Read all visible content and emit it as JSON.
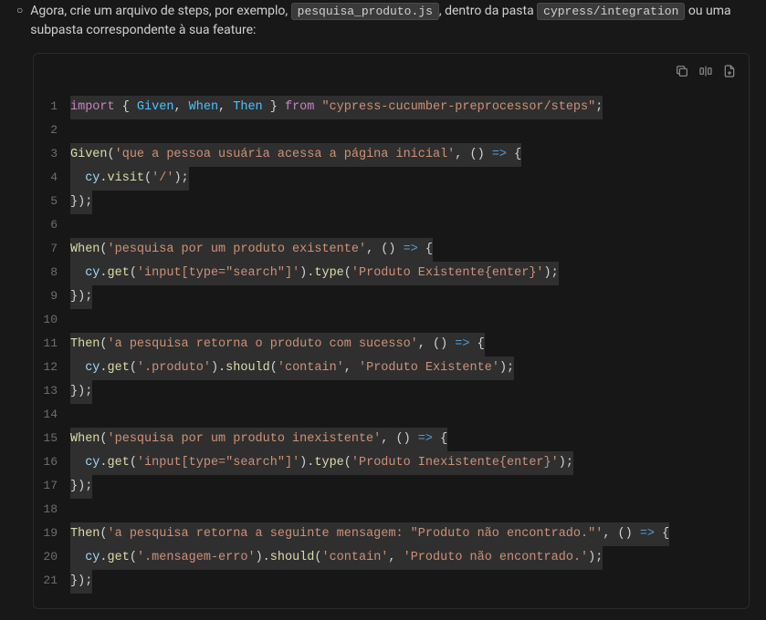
{
  "description": {
    "prefix": "Agora, crie um arquivo de steps, por exemplo, ",
    "file": "pesquisa_produto.js",
    "mid": ", dentro da pasta ",
    "folder": "cypress/integration",
    "suffix": " ou uma subpasta correspondente à sua feature:"
  },
  "toolbar": {
    "copy": "copy-icon",
    "insert": "insert-icon",
    "new": "new-file-icon"
  },
  "code": {
    "lines": {
      "1": {
        "import": "import",
        "lb": " { ",
        "g": "Given",
        "c1": ", ",
        "w": "When",
        "c2": ", ",
        "t": "Then",
        "rb": " } ",
        "from": "from",
        "sp": " ",
        "str": "\"cypress-cucumber-preprocessor/steps\"",
        "end": ";"
      },
      "3": {
        "fn": "Given",
        "op": "(",
        "str": "'que a pessoa usuária acessa a página inicial'",
        "cm": ", () ",
        "ar": "=>",
        "br": " {"
      },
      "4": {
        "ind": "  ",
        "cy": "cy",
        "dot": ".",
        "m": "visit",
        "op": "(",
        "str": "'/'",
        "cl": ");"
      },
      "5": {
        "end": "});"
      },
      "7": {
        "fn": "When",
        "op": "(",
        "str": "'pesquisa por um produto existente'",
        "cm": ", () ",
        "ar": "=>",
        "br": " {"
      },
      "8": {
        "ind": "  ",
        "cy": "cy",
        "dot": ".",
        "m": "get",
        "op": "(",
        "str": "'input[type=\"search\"]'",
        "cl": ").",
        "m2": "type",
        "op2": "(",
        "str2": "'Produto Existente{enter}'",
        "cl2": ");"
      },
      "9": {
        "end": "});"
      },
      "11": {
        "fn": "Then",
        "op": "(",
        "str": "'a pesquisa retorna o produto com sucesso'",
        "cm": ", () ",
        "ar": "=>",
        "br": " {"
      },
      "12": {
        "ind": "  ",
        "cy": "cy",
        "dot": ".",
        "m": "get",
        "op": "(",
        "str": "'.produto'",
        "cl": ").",
        "m2": "should",
        "op2": "(",
        "str2": "'contain'",
        "cm2": ", ",
        "str3": "'Produto Existente'",
        "cl2": ");"
      },
      "13": {
        "end": "});"
      },
      "15": {
        "fn": "When",
        "op": "(",
        "str": "'pesquisa por um produto inexistente'",
        "cm": ", () ",
        "ar": "=>",
        "br": " {"
      },
      "16": {
        "ind": "  ",
        "cy": "cy",
        "dot": ".",
        "m": "get",
        "op": "(",
        "str": "'input[type=\"search\"]'",
        "cl": ").",
        "m2": "type",
        "op2": "(",
        "str2": "'Produto Inexistente{enter}'",
        "cl2": ");"
      },
      "17": {
        "end": "});"
      },
      "19": {
        "fn": "Then",
        "op": "(",
        "str": "'a pesquisa retorna a seguinte mensagem: \"Produto não encontrado.\"'",
        "cm": ", () ",
        "ar": "=>",
        "br": " {"
      },
      "20": {
        "ind": "  ",
        "cy": "cy",
        "dot": ".",
        "m": "get",
        "op": "(",
        "str": "'.mensagem-erro'",
        "cl": ").",
        "m2": "should",
        "op2": "(",
        "str2": "'contain'",
        "cm2": ", ",
        "str3": "'Produto não encontrado.'",
        "cl2": ");"
      },
      "21": {
        "end": "});"
      }
    }
  }
}
